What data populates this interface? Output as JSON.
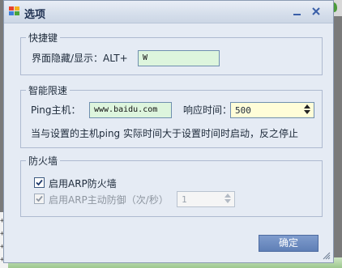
{
  "window": {
    "title": "选项",
    "app_icon": "options-app-icon",
    "minimize_icon": "minimize-icon",
    "close_icon": "close-icon"
  },
  "hotkey_group": {
    "title": "快捷键",
    "label": "界面隐藏/显示：ALT+",
    "value": "W"
  },
  "speed_group": {
    "title": "智能限速",
    "ping_label": "Ping主机：",
    "ping_host": "www.baidu.com",
    "response_label": "响应时间：",
    "response_value": "500",
    "description": "当与设置的主机ping 实际时间大于设置时间时启动，反之停止"
  },
  "firewall_group": {
    "title": "防火墙",
    "arp_firewall_label": "启用ARP防火墙",
    "arp_firewall_checked": true,
    "arp_defense_label": "启用ARP主动防御（次/秒）",
    "arp_defense_checked": true,
    "arp_defense_value": "1"
  },
  "ok_button": "确定",
  "background": {
    "marks": [
      "+]",
      "+]",
      "+]",
      "+]"
    ]
  },
  "colors": {
    "dialog_bg": "#e5ebf4",
    "input_green": "#ddf5dd",
    "button_blue": "#6f8dc2"
  }
}
